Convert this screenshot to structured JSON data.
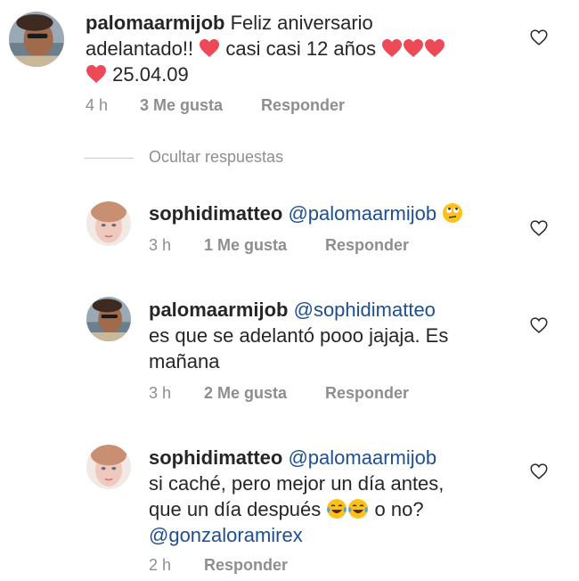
{
  "main_comment": {
    "username": "palomaarmijob",
    "text_1": "Feliz aniversario",
    "text_2": "adelantado!!",
    "text_3": "casi casi 12 años",
    "text_4": "25.04.09",
    "time": "4 h",
    "likes": "3 Me gusta",
    "reply": "Responder"
  },
  "hide_replies": "Ocultar respuestas",
  "replies": [
    {
      "username": "sophidimatteo",
      "mention": "@palomaarmijob",
      "time": "3 h",
      "likes": "1 Me gusta",
      "reply": "Responder"
    },
    {
      "username": "palomaarmijob",
      "mention": "@sophidimatteo",
      "line_2": "es que se adelantó pooo jajaja. Es",
      "line_3": "mañana",
      "time": "3 h",
      "likes": "2 Me gusta",
      "reply": "Responder"
    },
    {
      "username": "sophidimatteo",
      "mention": "@palomaarmijob",
      "line_2": "si caché, pero mejor un día antes,",
      "line_3a": "que un día después",
      "line_3b": "o no?",
      "mention_2": "@gonzaloramirex",
      "time": "2 h",
      "reply": "Responder"
    }
  ],
  "colors": {
    "heart": "#ed4956",
    "mention": "#1d4f91",
    "meta": "#8e8e8e"
  }
}
